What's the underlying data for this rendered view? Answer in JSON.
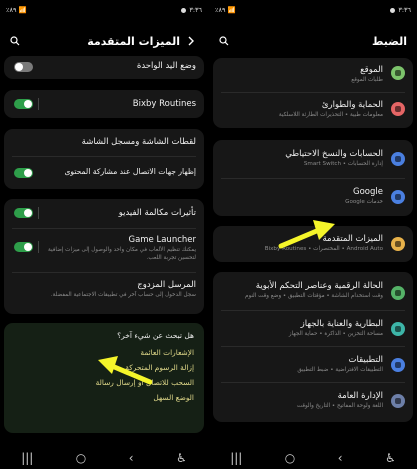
{
  "left": {
    "status_time": "٣:٣٦",
    "status_left": "٪٨٩ 📶",
    "title": "الميزات المتقدمة",
    "rows": {
      "one_hand": "وضع اليد الواحدة",
      "bixby": "Bixby Routines",
      "screenshots": "لقطات الشاشة ومسجل الشاشة",
      "show_contacts": "إظهار جهات الاتصال عند مشاركة المحتوى",
      "video_call": "تأثيرات مكالمة الفيديو",
      "game_launcher": "Game Launcher",
      "game_launcher_sub": "يمكنك تنظيم الألعاب في مكان واحد والوصول إلى ميزات إضافية لتحسين تجربة اللعب.",
      "dual_messenger": "المرسل المزدوج",
      "dual_messenger_sub": "سجل الدخول إلى حساب آخر في تطبيقات الاجتماعية المفضلة."
    },
    "suggest": {
      "question": "هل تبحث عن شيء آخر؟",
      "links": [
        "الإشعارات العائمة",
        "إزالة الرسوم المتحركة",
        "السحب للاتصال أو إرسال رسالة",
        "الوضع السهل"
      ]
    }
  },
  "right": {
    "status_time": "٣:٣٦",
    "status_left": "٪٨٩ 📶",
    "title": "الضبط",
    "items": [
      {
        "title": "الموقع",
        "sub": "طلبات الموقع",
        "color": "#7cc36b"
      },
      {
        "title": "الحماية والطوارئ",
        "sub": "معلومات طبية • التحذيرات الطارئة اللاسلكية",
        "color": "#e56565"
      },
      {
        "title": "الحسابات والنسخ الاحتياطي",
        "sub": "إدارة الحسابات • Smart Switch",
        "color": "#4a7fe0"
      },
      {
        "title": "Google",
        "sub": "خدمات Google",
        "color": "#4a7fe0"
      },
      {
        "title": "الميزات المتقدمة",
        "sub": "Android Auto • المختصرات • Bixby Routines",
        "color": "#e8b24a"
      },
      {
        "title": "الحالة الرقمية وعناصر التحكم الأبوية",
        "sub": "وقت استخدام الشاشة • مؤقتات التطبيق • وضع وقت النوم",
        "color": "#55b267"
      },
      {
        "title": "البطارية والعناية بالجهاز",
        "sub": "مساحة التخزين • الذاكرة • حماية الجهاز",
        "color": "#3db5a8"
      },
      {
        "title": "التطبيقات",
        "sub": "التطبيقات الافتراضية • ضبط التطبيق",
        "color": "#4a7fe0"
      },
      {
        "title": "الإدارة العامة",
        "sub": "اللغة ولوحة المفاتيح • التاريخ والوقت",
        "color": "#6d7fa8"
      }
    ]
  },
  "colors": {
    "arrow": "#f5f52a",
    "toggle_on": "#2e9e4a"
  }
}
